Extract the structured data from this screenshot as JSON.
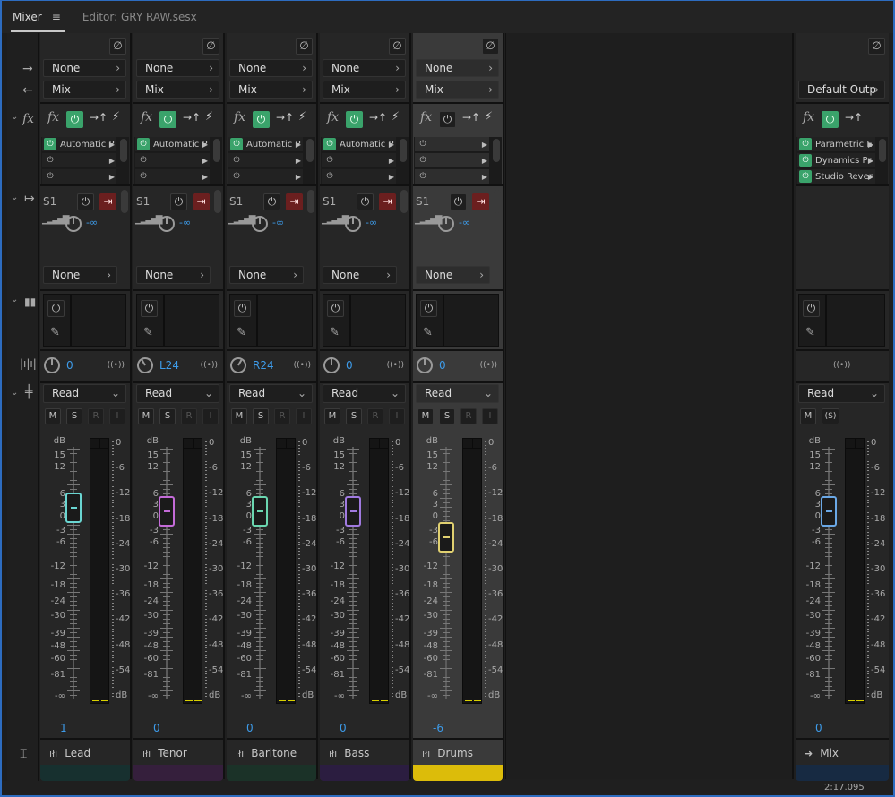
{
  "tabs": {
    "active": "Mixer",
    "menu_icon": "≡",
    "editor": "Editor: GRY RAW.sesx"
  },
  "gutter": {
    "chevron": "⌄"
  },
  "strips": [
    {
      "name": "Lead",
      "input": "None",
      "output": "Mix",
      "fx": [
        "Automatic P",
        null,
        null
      ],
      "send": "S1",
      "send_val": "-∞",
      "send_out": "None",
      "pan": "0",
      "pan_angle": 0,
      "auto": "Read",
      "vol": "1",
      "fader_db": 1,
      "color": "#6ad6d2",
      "track_color": "#17302f",
      "selected": false
    },
    {
      "name": "Tenor",
      "input": "None",
      "output": "Mix",
      "fx": [
        "Automatic P",
        null,
        null
      ],
      "send": "S1",
      "send_val": "-∞",
      "send_out": "None",
      "pan": "L24",
      "pan_angle": -30,
      "auto": "Read",
      "vol": "0",
      "fader_db": 0,
      "color": "#c46bd8",
      "track_color": "#351f3c",
      "selected": false
    },
    {
      "name": "Baritone",
      "input": "None",
      "output": "Mix",
      "fx": [
        "Automatic P",
        null,
        null
      ],
      "send": "S1",
      "send_val": "-∞",
      "send_out": "None",
      "pan": "R24",
      "pan_angle": 30,
      "auto": "Read",
      "vol": "0",
      "fader_db": 0,
      "color": "#6ad6b0",
      "track_color": "#1b3228",
      "selected": false
    },
    {
      "name": "Bass",
      "input": "None",
      "output": "Mix",
      "fx": [
        "Automatic P",
        null,
        null
      ],
      "send": "S1",
      "send_val": "-∞",
      "send_out": "None",
      "pan": "0",
      "pan_angle": 0,
      "auto": "Read",
      "vol": "0",
      "fader_db": 0,
      "color": "#a07ae0",
      "track_color": "#2b1d40",
      "selected": false
    },
    {
      "name": "Drums",
      "input": "None",
      "output": "Mix",
      "fx": [
        null,
        null,
        null
      ],
      "send": "S1",
      "send_val": "-∞",
      "send_out": "None",
      "pan": "0",
      "pan_angle": 0,
      "auto": "Read",
      "vol": "-6",
      "fader_db": -6,
      "color": "#e0d070",
      "track_color": "#dcbc0a",
      "selected": true
    }
  ],
  "master": {
    "name": "Mix",
    "output": "Default Outp",
    "fx": [
      "Parametric E",
      "Dynamics Pr",
      "Studio Rever"
    ],
    "auto": "Read",
    "vol": "0",
    "fader_db": 0,
    "color": "#6aa8e6",
    "track_color": "#172a42"
  },
  "fader_scale": [
    "dB",
    "15",
    "12",
    "6",
    "3",
    "0",
    "-3",
    "-6",
    "-12",
    "-18",
    "-24",
    "-30",
    "-39",
    "-48",
    "-60",
    "-81",
    "-∞"
  ],
  "meter_scale": [
    "0",
    "-6",
    "-12",
    "-18",
    "-24",
    "-30",
    "-36",
    "-42",
    "-48",
    "-54",
    "dB"
  ],
  "labels": {
    "none": "None",
    "mix": "Mix",
    "m": "M",
    "s": "S",
    "r": "R",
    "i": "I",
    "solo_safe": "(S)"
  },
  "status": {
    "time": "2:17.095"
  }
}
